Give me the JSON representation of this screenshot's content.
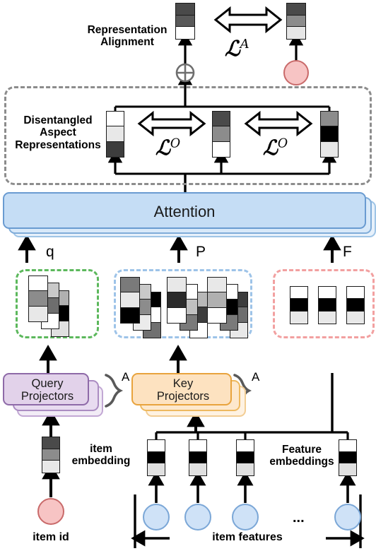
{
  "diagram": {
    "title_labels": {
      "representation_alignment": "Representation\nAlignment",
      "disentangled_aspect": "Disentangled\nAspect\nRepresentations",
      "attention": "Attention",
      "query_projectors": "Query\nProjectors",
      "key_projectors": "Key\nProjectors",
      "item_embedding": "item\nembedding",
      "feature_embeddings": "Feature\nembeddings",
      "item_id": "item id",
      "item_features": "item features",
      "ellipsis": "..."
    },
    "losses": {
      "alignment_loss": {
        "symbol": "L",
        "superscript": "A"
      },
      "orthogonality_loss_1": {
        "symbol": "L",
        "superscript": "O"
      },
      "orthogonality_loss_2": {
        "symbol": "L",
        "superscript": "O"
      }
    },
    "signal_labels": {
      "query": "q",
      "keys": "P",
      "features": "F",
      "aspect_count_query": "A",
      "aspect_count_key": "A"
    },
    "colors": {
      "attention_fill": "#c5ddf5",
      "attention_stroke": "#6a9bd1",
      "query_fill": "#e2d2ea",
      "query_stroke": "#8e6aa8",
      "key_fill": "#fde2c0",
      "key_stroke": "#e8a33d",
      "query_box_dash": "#5cb85c",
      "key_box_dash": "#9dc3e8",
      "feature_box_dash": "#f2a0a0",
      "outer_dash": "#8c8c8c",
      "item_id_fill": "#f7c4c4",
      "item_id_stroke": "#c96a6a",
      "feature_node_fill": "#cfe2f7",
      "feature_node_stroke": "#7ba7d7",
      "vector_border": "#1a1a1a",
      "arrow_black": "#000000",
      "brace_gray": "#595959"
    },
    "vectors": {
      "fused_representation": {
        "name": "fused-representation-vector",
        "cells": [
          "#4a4a4a",
          "#595959",
          "#ffffff"
        ]
      },
      "item_id_representation": {
        "name": "item-id-representation-vector",
        "cells": [
          "#4a4a4a",
          "#8c8c8c",
          "#e6e6e6"
        ]
      },
      "aspect_1": {
        "name": "aspect-representation-1",
        "cells": [
          "#ffffff",
          "#e8e8e8",
          "#3d3d3d"
        ]
      },
      "aspect_2": {
        "name": "aspect-representation-2",
        "cells": [
          "#4a4a4a",
          "#8c8c8c",
          "#ffffff"
        ]
      },
      "aspect_3": {
        "name": "aspect-representation-3",
        "cells": [
          "#8c8c8c",
          "#000000",
          "#e8e8e8"
        ]
      },
      "item_embedding": {
        "name": "item-embedding-vector",
        "cells": [
          "#4a4a4a",
          "#8c8c8c",
          "#e8e8e8"
        ]
      },
      "feature_embedding": {
        "name": "feature-embedding-vector",
        "cells": [
          "#ffffff",
          "#000000",
          "#e0e0e0"
        ]
      },
      "query_cascade": [
        {
          "name": "query-projection-1",
          "cells": [
            "#ffffff",
            "#8c8c8c",
            "#e8e8e8"
          ]
        },
        {
          "name": "query-projection-2",
          "cells": [
            "#c9c9c9",
            "#6e6e6e",
            "#ffffff"
          ]
        },
        {
          "name": "query-projection-3",
          "cells": [
            "#b0b0b0",
            "#000000",
            "#e0e0e0"
          ]
        }
      ],
      "key_cascade_1": [
        {
          "name": "key-projection-1-1",
          "cells": [
            "#7a7a7a",
            "#e8e8e8",
            "#000000"
          ]
        },
        {
          "name": "key-projection-1-2",
          "cells": [
            "#c9c9c9",
            "#8c8c8c",
            "#ebebeb"
          ]
        },
        {
          "name": "key-projection-1-3",
          "cells": [
            "#000000",
            "#ffffff",
            "#707070"
          ]
        }
      ],
      "key_cascade_2": [
        {
          "name": "key-projection-2-1",
          "cells": [
            "#e8e8e8",
            "#2b2b2b",
            "#ffffff"
          ]
        },
        {
          "name": "key-projection-2-2",
          "cells": [
            "#ffffff",
            "#c0c0c0",
            "#7a7a7a"
          ]
        },
        {
          "name": "key-projection-2-3",
          "cells": [
            "#b8b8b8",
            "#3d3d3d",
            "#ffffff"
          ]
        }
      ],
      "key_cascade_3": [
        {
          "name": "key-projection-3-1",
          "cells": [
            "#e8e8e8",
            "#b0b0b0",
            "#ffffff"
          ]
        },
        {
          "name": "key-projection-3-2",
          "cells": [
            "#ffffff",
            "#000000",
            "#7a7a7a"
          ]
        },
        {
          "name": "key-projection-3-3",
          "cells": [
            "#3d3d3d",
            "#6e6e6e",
            "#e8e8e8"
          ]
        }
      ],
      "feature_group": [
        {
          "name": "feature-vector-1",
          "cells": [
            "#ffffff",
            "#000000",
            "#e8e8e8"
          ]
        },
        {
          "name": "feature-vector-2",
          "cells": [
            "#ffffff",
            "#000000",
            "#e8e8e8"
          ]
        },
        {
          "name": "feature-vector-3",
          "cells": [
            "#ffffff",
            "#000000",
            "#e8e8e8"
          ]
        }
      ]
    },
    "nodes": {
      "item_id_node": "item-id-node",
      "feature_nodes": [
        "feature-node-1",
        "feature-node-2",
        "feature-node-3",
        "feature-node-4"
      ]
    },
    "operators": {
      "sum_node": "⊕",
      "double_arrow_top": "double-headed-arrow",
      "double_arrow_left": "double-headed-arrow",
      "double_arrow_right": "double-headed-arrow"
    }
  }
}
